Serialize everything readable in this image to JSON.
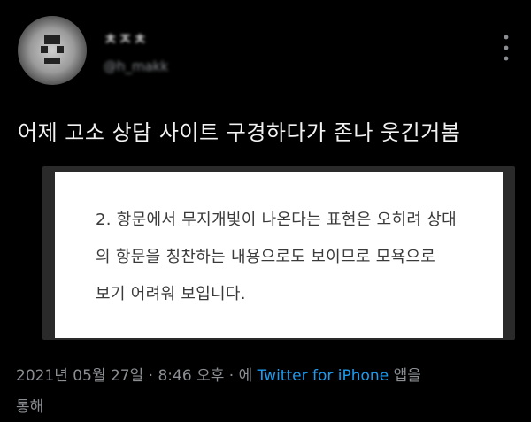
{
  "tweet": {
    "user_name": "ㅊㅈㅊ",
    "user_handle": "@h_makk",
    "text": "어제 고소 상담 사이트 구경하다가 존나 웃긴거봄",
    "image_text": {
      "line1": "2. 항문에서 무지개빛이 나온다는 표현은 오히려 상대",
      "line2": "의 항문을 칭찬하는 내용으로도 보이므로 모욕으로",
      "line3": "보기 어려워 보입니다."
    },
    "meta": {
      "date": "2021년 05월 27일",
      "sep1": "·",
      "time": "8:46 오후",
      "sep2": "·",
      "via_prefix": "에",
      "source": "Twitter for iPhone",
      "via_suffix_1": "앱을",
      "via_suffix_2": "통해"
    }
  },
  "icons": {
    "more": "more-vertical-icon",
    "avatar": "avatar"
  },
  "colors": {
    "background": "#000000",
    "text": "#f2f2f2",
    "muted": "#8b8f93",
    "link": "#1d9bf0",
    "card_bg": "#ffffff"
  }
}
